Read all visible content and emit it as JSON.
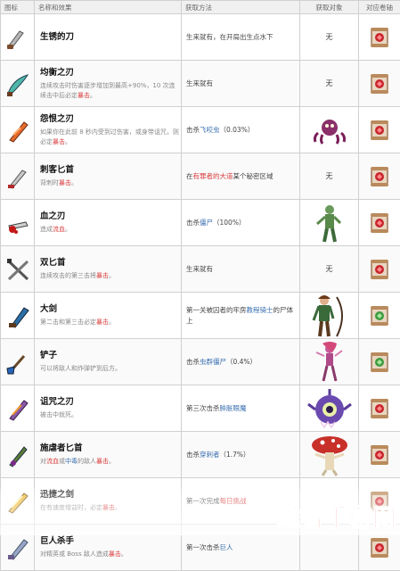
{
  "header": {
    "icon": "图标",
    "name_effect": "名称和效果",
    "method": "获取方法",
    "target": "获取对象",
    "scroll": "对应卷轴"
  },
  "rows": [
    {
      "name": "生锈的刀",
      "effect": [],
      "method": [
        {
          "t": "生来就有，在开局出生点水下"
        }
      ],
      "target_text": "无",
      "icon": "rusty-knife-icon",
      "scroll": "brutality-scroll-icon"
    },
    {
      "name": "均衡之刃",
      "effect": [
        {
          "t": "连续攻击时伤害逐步增加到最高+90%，10 次连续击中后必定"
        },
        {
          "t": "暴击",
          "red": true
        },
        {
          "t": "。"
        }
      ],
      "method": [
        {
          "t": "生来就有"
        }
      ],
      "target_text": "无",
      "icon": "balanced-blade-icon",
      "scroll": "brutality-scroll-icon"
    },
    {
      "name": "怨恨之刃",
      "effect": [
        {
          "t": "如果你在此前 8 秒内受到过伤害，或身带诅咒，则必定"
        },
        {
          "t": "暴击",
          "red": true
        },
        {
          "t": "。"
        }
      ],
      "method": [
        {
          "t": "击杀"
        },
        {
          "t": "飞咬虫",
          "blue": true
        },
        {
          "t": "（0.03%）"
        }
      ],
      "target_text": "",
      "icon": "spite-sword-icon",
      "scroll": "brutality-scroll-icon"
    },
    {
      "name": "刺客匕首",
      "effect": [
        {
          "t": "背刺时"
        },
        {
          "t": "暴击",
          "red": true
        },
        {
          "t": "。"
        }
      ],
      "method": [
        {
          "t": "在"
        },
        {
          "t": "有罪者的大道",
          "red": true
        },
        {
          "t": "某个秘密区域"
        }
      ],
      "target_text": "无",
      "icon": "assassin-dagger-icon",
      "scroll": "brutality-scroll-icon"
    },
    {
      "name": "血之刃",
      "effect": [
        {
          "t": "造成"
        },
        {
          "t": "流血",
          "red": true
        },
        {
          "t": "。"
        }
      ],
      "method": [
        {
          "t": "击杀"
        },
        {
          "t": "僵尸",
          "blue": true
        },
        {
          "t": "（100%）"
        }
      ],
      "target_text": "",
      "icon": "blood-sword-icon",
      "scroll": "brutality-scroll-icon"
    },
    {
      "name": "双匕首",
      "effect": [
        {
          "t": "连续攻击的第三击将"
        },
        {
          "t": "暴击",
          "red": true
        },
        {
          "t": "。"
        }
      ],
      "method": [
        {
          "t": "生来就有"
        }
      ],
      "target_text": "无",
      "icon": "twin-daggers-icon",
      "scroll": "brutality-scroll-icon"
    },
    {
      "name": "大剑",
      "effect": [
        {
          "t": "第二击和第三击必定"
        },
        {
          "t": "暴击",
          "red": true
        },
        {
          "t": "。"
        }
      ],
      "method": [
        {
          "t": "第一关被囚者的牢房"
        },
        {
          "t": "教程骑士",
          "blue": true
        },
        {
          "t": "的尸体上"
        }
      ],
      "target_text": "",
      "icon": "broadsword-icon",
      "scroll": "survival-scroll-icon"
    },
    {
      "name": "铲子",
      "effect": [
        {
          "t": "可以将敌人和炸弹铲到后方。"
        }
      ],
      "method": [
        {
          "t": "击杀"
        },
        {
          "t": "虫群僵尸",
          "blue": true
        },
        {
          "t": "（0.4%）"
        }
      ],
      "target_text": "",
      "icon": "shovel-icon",
      "scroll": "survival-scroll-icon"
    },
    {
      "name": "诅咒之刃",
      "effect": [
        {
          "t": "被击中就死。"
        }
      ],
      "method": [
        {
          "t": "第三次击杀"
        },
        {
          "t": "肿胀眼魔",
          "blue": true
        }
      ],
      "target_text": "",
      "icon": "cursed-sword-icon",
      "scroll": "brutality-scroll-icon"
    },
    {
      "name": "施虐者匕首",
      "effect": [
        {
          "t": "对"
        },
        {
          "t": "流血",
          "red": true
        },
        {
          "t": "或"
        },
        {
          "t": "中毒",
          "blue": true
        },
        {
          "t": "的敌人"
        },
        {
          "t": "暴击",
          "red": true
        },
        {
          "t": "。"
        }
      ],
      "method": [
        {
          "t": "击杀"
        },
        {
          "t": "穿刺者",
          "blue": true
        },
        {
          "t": "（1.7%）"
        }
      ],
      "target_text": "",
      "icon": "sadist-stiletto-icon",
      "scroll": "brutality-scroll-icon"
    },
    {
      "name": "迅捷之剑",
      "effect": [
        {
          "t": "在有速度增益时，必定"
        },
        {
          "t": "暴击",
          "red": true
        },
        {
          "t": "。"
        }
      ],
      "method": [
        {
          "t": "第一次完成"
        },
        {
          "t": "每日挑战",
          "red": true
        }
      ],
      "target_text": "",
      "icon": "swift-sword-icon",
      "scroll": "brutality-scroll-icon"
    },
    {
      "name": "巨人杀手",
      "effect": [
        {
          "t": "对精英或 Boss 敌人造成"
        },
        {
          "t": "暴击",
          "red": true
        },
        {
          "t": "。"
        }
      ],
      "method": [
        {
          "t": "第一次击杀"
        },
        {
          "t": "巨人",
          "blue": true
        }
      ],
      "target_text": "",
      "icon": "giant-killer-icon",
      "scroll": "brutality-scroll-icon"
    }
  ],
  "watermark": "维普手游网",
  "colors": {
    "red": "#d83b3b",
    "blue": "#3a6fb0",
    "header_bg": "#f0f0f0",
    "grid": "#d0d0d0",
    "watermark": "#e2282c"
  }
}
